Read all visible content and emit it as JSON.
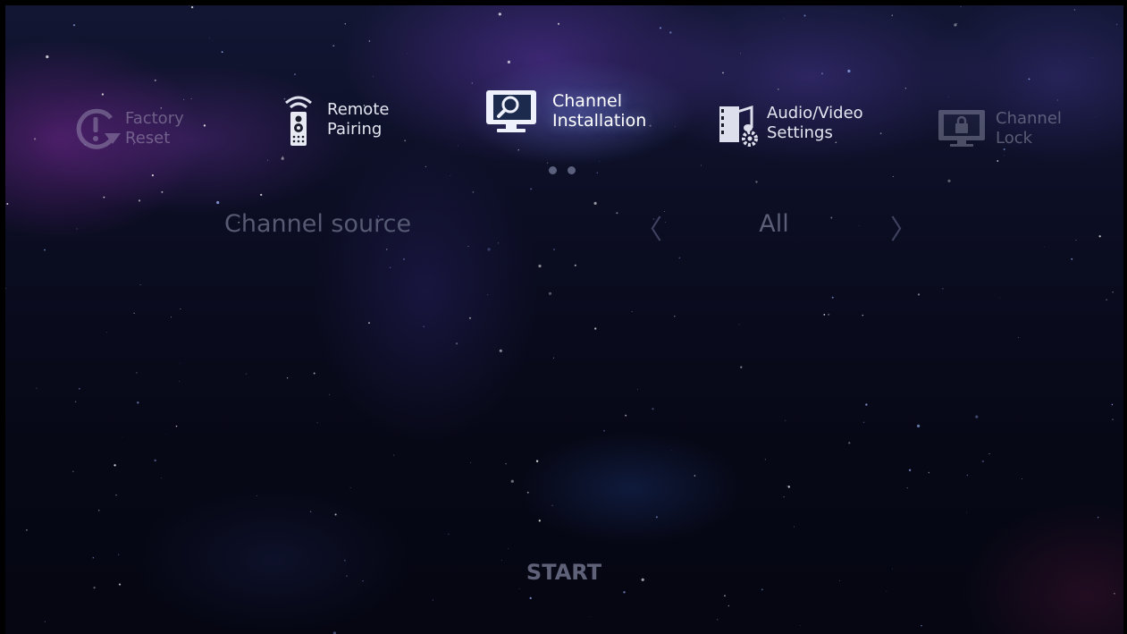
{
  "menu": {
    "items": [
      {
        "id": "factory-reset",
        "label": "Factory\nReset",
        "icon": "factory-reset-icon"
      },
      {
        "id": "remote-pairing",
        "label": "Remote\nPairing",
        "icon": "remote-icon"
      },
      {
        "id": "channel-installation",
        "label": "Channel\nInstallation",
        "icon": "tv-search-icon",
        "selected": true
      },
      {
        "id": "audio-video-settings",
        "label": "Audio/Video\nSettings",
        "icon": "media-settings-icon"
      },
      {
        "id": "channel-lock",
        "label": "Channel\nLock",
        "icon": "tv-lock-icon"
      }
    ],
    "page_indicator": {
      "pages": 2,
      "current": 1
    }
  },
  "channel_source": {
    "label": "Channel source",
    "value": "All",
    "prev_arrow": "〈",
    "next_arrow": "〉"
  },
  "start_button": "START",
  "colors": {
    "selected_text": "#ffffff",
    "normal_text": "#e3e6f0",
    "dim_text": "#565a72",
    "background": "#070816"
  }
}
